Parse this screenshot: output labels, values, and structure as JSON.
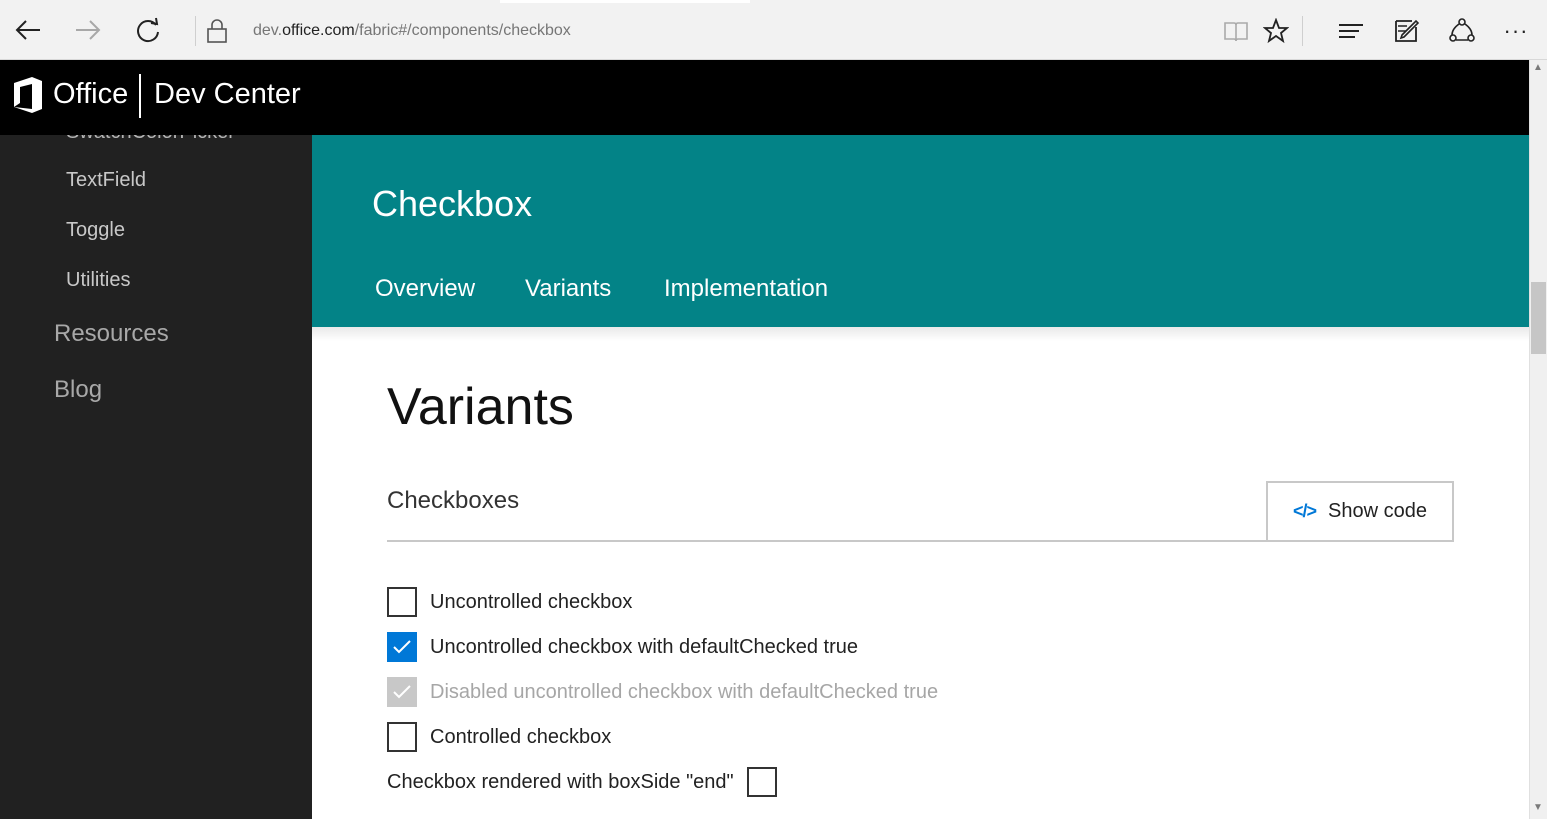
{
  "browser": {
    "url_prefix": "dev.",
    "url_host": "office.com",
    "url_path": "/fabric#/components/checkbox",
    "more_label": "···"
  },
  "header": {
    "brand": "Office",
    "product": "Dev Center"
  },
  "sidebar": {
    "partial_item": "SwatchColorPicker",
    "sub_items": [
      "TextField",
      "Toggle",
      "Utilities"
    ],
    "top_items": [
      "Resources",
      "Blog"
    ]
  },
  "hero": {
    "title": "Checkbox",
    "tabs": [
      "Overview",
      "Variants",
      "Implementation"
    ]
  },
  "content": {
    "heading": "Variants",
    "example_title": "Checkboxes",
    "show_code_label": "Show code",
    "show_code_icon": "</>",
    "checkboxes": [
      {
        "label": "Uncontrolled checkbox",
        "checked": false,
        "disabled": false
      },
      {
        "label": "Uncontrolled checkbox with defaultChecked true",
        "checked": true,
        "disabled": false
      },
      {
        "label": "Disabled uncontrolled checkbox with defaultChecked true",
        "checked": true,
        "disabled": true
      },
      {
        "label": "Controlled checkbox",
        "checked": false,
        "disabled": false
      },
      {
        "label": "Checkbox rendered with boxSide \"end\"",
        "checked": false,
        "disabled": false
      }
    ]
  },
  "colors": {
    "hero_teal": "#038387",
    "checkbox_blue": "#0078d7",
    "sidebar_bg": "#212121",
    "header_bg": "#000000"
  },
  "icons": [
    "back-arrow-icon",
    "forward-arrow-icon",
    "refresh-icon",
    "lock-icon",
    "reading-view-icon",
    "favorite-star-icon",
    "hub-icon",
    "web-note-icon",
    "share-icon",
    "more-icon",
    "office-logo-icon",
    "code-icon",
    "checkmark-icon"
  ]
}
